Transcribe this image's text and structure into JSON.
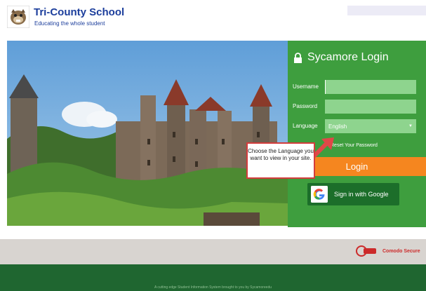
{
  "header": {
    "school_name": "Tri-County School",
    "tagline": "Educating the whole student"
  },
  "login": {
    "title": "Sycamore Login",
    "username_label": "Username",
    "password_label": "Password",
    "language_label": "Language",
    "language_selected": "English",
    "reset_link": "Reset Your Password",
    "login_button": "Login",
    "google_button": "Sign in with Google"
  },
  "callout": {
    "text": "Choose the Language you want to view in your site."
  },
  "footer": {
    "secure_label": "Comodo Secure",
    "powered_text": "A cutting edge Student Information System brought to you by Sycamoreedu"
  },
  "colors": {
    "panel_green": "#3e9e3e",
    "login_orange": "#f5861f",
    "footer_green": "#1f6630",
    "brand_blue": "#1c3e9c",
    "callout_red": "#d43c3c"
  },
  "icons": [
    "bulldog-logo-icon",
    "lock-icon",
    "google-icon",
    "chevron-down-icon",
    "comodo-secure-icon"
  ]
}
